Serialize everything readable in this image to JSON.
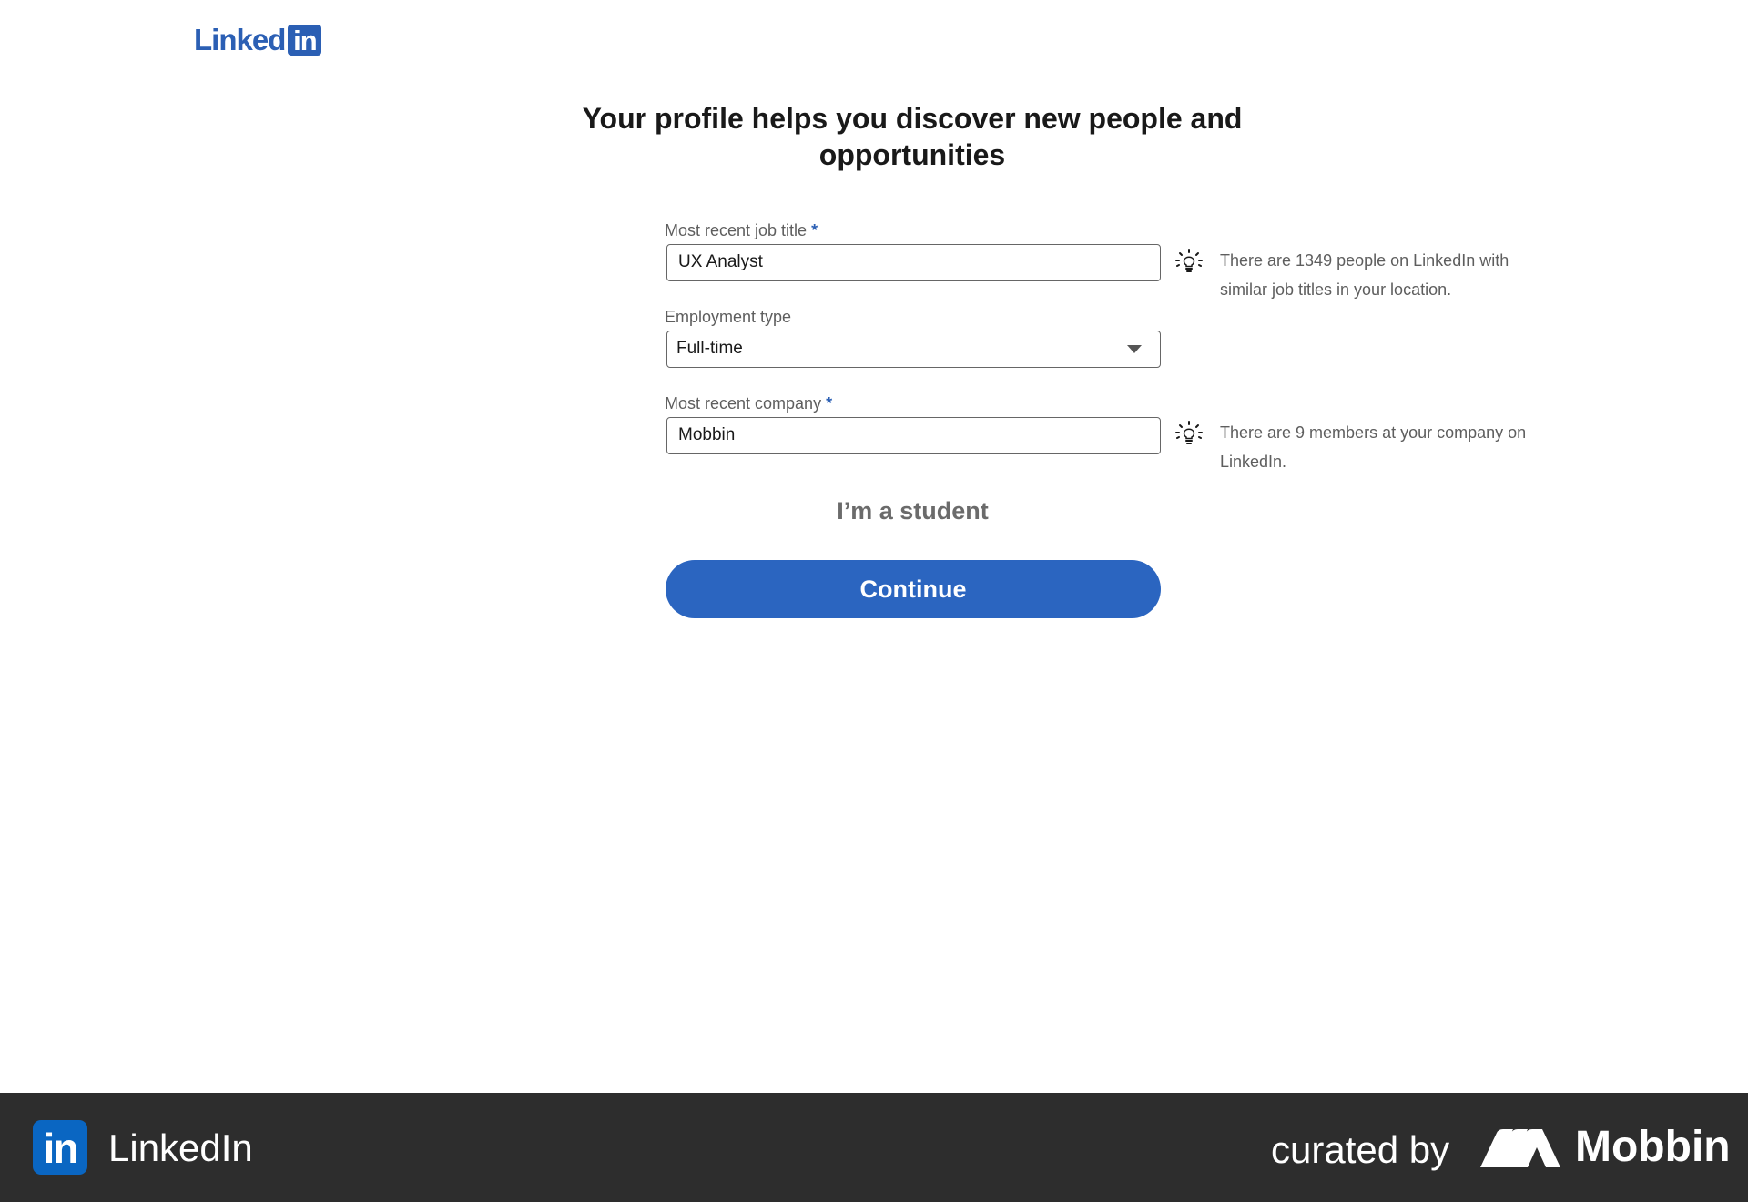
{
  "logo": {
    "word": "Linked",
    "box": "in"
  },
  "heading": "Your profile helps you discover new people and opportunities",
  "form": {
    "job_title": {
      "label": "Most recent job title",
      "required": "*",
      "value": "UX Analyst"
    },
    "employment_type": {
      "label": "Employment type",
      "value": "Full-time"
    },
    "company": {
      "label": "Most recent company",
      "required": "*",
      "value": "Mobbin"
    }
  },
  "hints": {
    "job_title": "There are 1349 people on LinkedIn with similar job titles in your location.",
    "company": "There are 9 members at your company on LinkedIn."
  },
  "student_link": "I’m a student",
  "continue_button": "Continue",
  "footer": {
    "app_icon": "in",
    "app_name": "LinkedIn",
    "curated_by": "curated by",
    "brand": "Mobbin"
  },
  "colors": {
    "accent": "#2b65c0",
    "footer_bg": "#2d2d2d"
  }
}
